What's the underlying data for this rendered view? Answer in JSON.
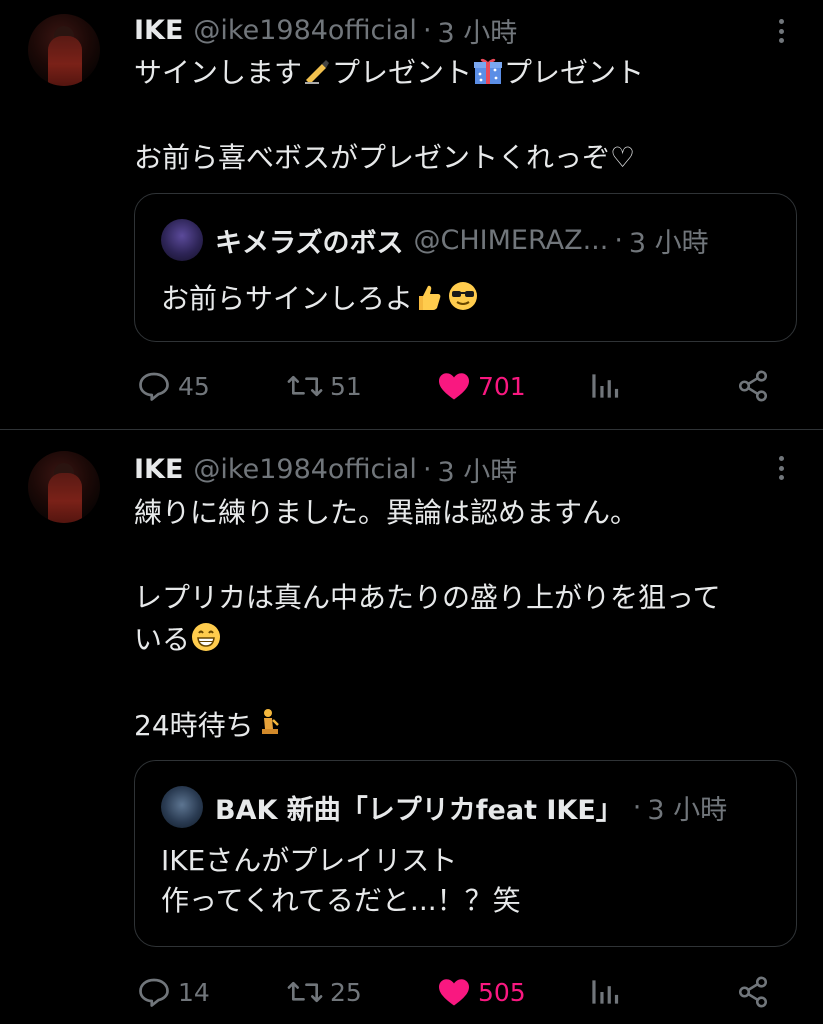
{
  "colors": {
    "background": "#000000",
    "text": "#e7e9ea",
    "muted": "#71767b",
    "border": "#2f3336",
    "like": "#f91880"
  },
  "tweets": [
    {
      "name": "IKE",
      "handle": "@ike1984official",
      "time": "3 小時",
      "text_line1": "サインします",
      "text_line1b": "プレゼント",
      "text_line1c": "プレゼント",
      "text_line2": "お前ら喜べボスがプレゼントくれっぞ♡",
      "quote": {
        "name": "キメラズのボス",
        "handle": "@CHIMERAZ...",
        "time": "3 小時",
        "text": "お前らサインしろよ"
      },
      "replies": "45",
      "retweets": "51",
      "likes": "701"
    },
    {
      "name": "IKE",
      "handle": "@ike1984official",
      "time": "3 小時",
      "text_line1": "練りに練りました。異論は認めますん。",
      "text_line2": "レプリカは真ん中あたりの盛り上がりを狙って",
      "text_line3": "いる",
      "text_line4": "24時待ち",
      "quote": {
        "name": "BAK 新曲「レプリカfeat IKE」",
        "time": "3 小時",
        "text_line1": "IKEさんがプレイリスト",
        "text_line2": "作ってくれてるだと...！？笑"
      },
      "replies": "14",
      "retweets": "25",
      "likes": "505"
    }
  ],
  "icons": [
    "reply-icon",
    "retweet-icon",
    "like-icon",
    "views-icon",
    "share-icon",
    "more-icon"
  ]
}
